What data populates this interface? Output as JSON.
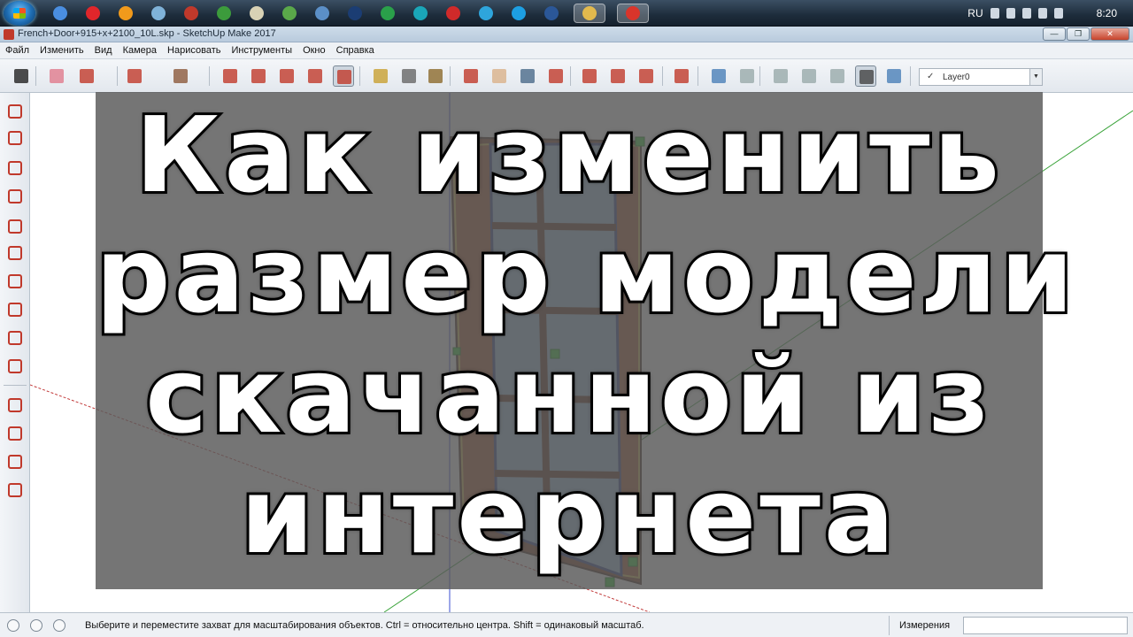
{
  "taskbar": {
    "apps": [
      {
        "icon": "chrome-icon",
        "color": "#4a8ee0"
      },
      {
        "icon": "opera-icon",
        "color": "#e0262b"
      },
      {
        "icon": "avast-icon",
        "color": "#f19a1b"
      },
      {
        "icon": "paint-icon",
        "color": "#7fb2d8"
      },
      {
        "icon": "sketchup-old-icon",
        "color": "#c0392b"
      },
      {
        "icon": "utorrent-icon",
        "color": "#3c9b3c"
      },
      {
        "icon": "notepad-icon",
        "color": "#d8d2b5"
      },
      {
        "icon": "chrome-alt-icon",
        "color": "#5aa84a"
      },
      {
        "icon": "remote-desktop-icon",
        "color": "#5b8fc7"
      },
      {
        "icon": "photoshop-icon",
        "color": "#1b3d73"
      },
      {
        "icon": "skype-green-icon",
        "color": "#2aa04a"
      },
      {
        "icon": "cube-icon",
        "color": "#1aa6b8"
      },
      {
        "icon": "record-icon",
        "color": "#d02a2a"
      },
      {
        "icon": "telegram-icon",
        "color": "#2ea5dc"
      },
      {
        "icon": "skype-icon",
        "color": "#1d9fe3"
      },
      {
        "icon": "word-icon",
        "color": "#2b5797"
      },
      {
        "icon": "explorer-icon",
        "color": "#e2b94d"
      },
      {
        "icon": "sketchup-icon",
        "color": "#d9352b"
      }
    ],
    "lang": "RU",
    "clock": "8:20"
  },
  "window": {
    "title": "French+Door+915+x+2100_10L.skp - SketchUp Make 2017",
    "ctrl_minimize": "—",
    "ctrl_maximize": "❐",
    "ctrl_close": "✕"
  },
  "menu": [
    "Файл",
    "Изменить",
    "Вид",
    "Камера",
    "Нарисовать",
    "Инструменты",
    "Окно",
    "Справка"
  ],
  "layer": {
    "check": "✓",
    "name": "Layer0",
    "arrow": "▼"
  },
  "headline": {
    "line1": "Как изменить",
    "line2": "размер модели",
    "line3": "скачанной из",
    "line4": "интернета"
  },
  "status": {
    "hint": "Выберите и переместите захват для масштабирования объектов. Ctrl = относительно центра. Shift = одинаковый масштаб.",
    "measurements_label": "Измерения",
    "measurements_value": ""
  }
}
